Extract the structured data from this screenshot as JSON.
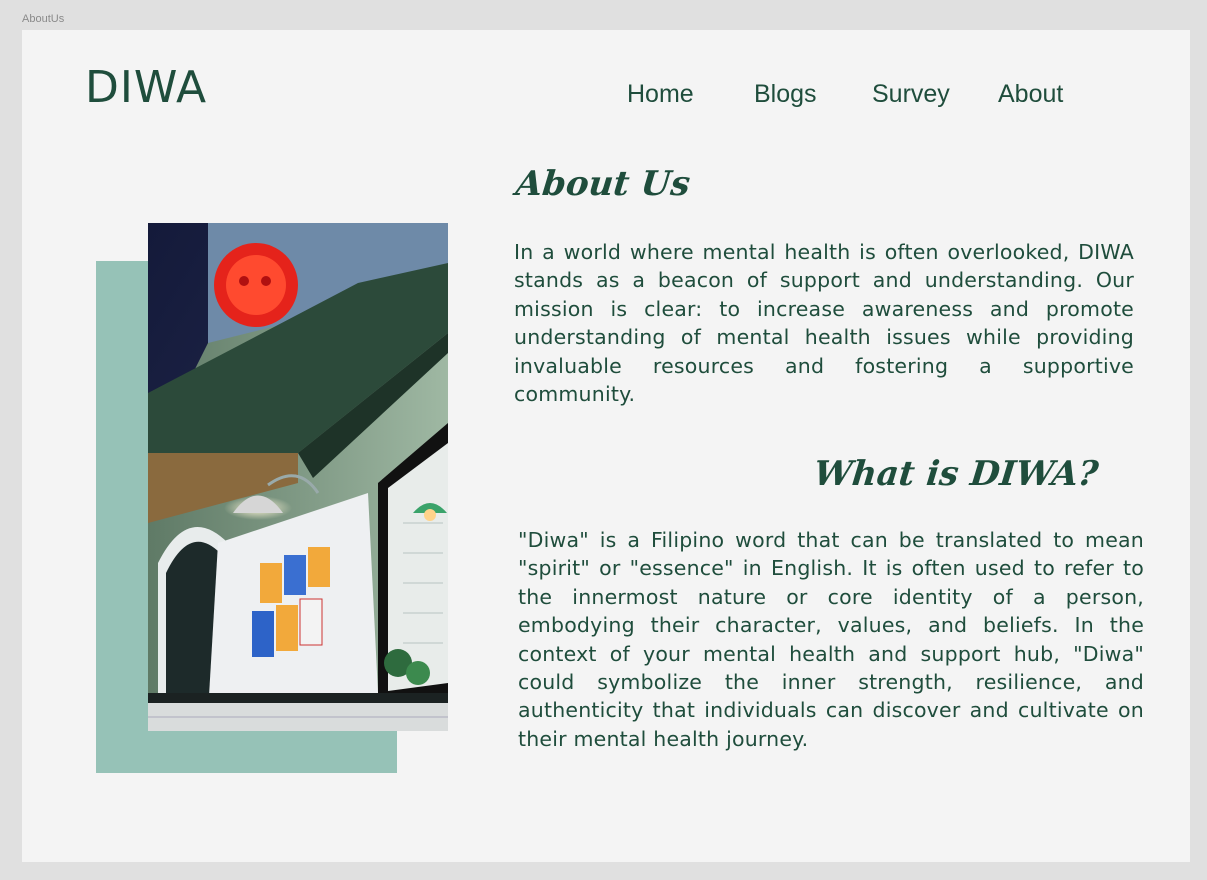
{
  "frame_label": "AboutUs",
  "brand": {
    "logo_text": "DIWA"
  },
  "nav": {
    "items": [
      {
        "label": "Home"
      },
      {
        "label": "Blogs"
      },
      {
        "label": "Survey"
      },
      {
        "label": "About"
      }
    ]
  },
  "about": {
    "heading": "About Us",
    "body": "In a world where mental health is often overlooked, DIWA stands as a beacon of support and understanding. Our mission is clear: to increase awareness and promote understanding of mental health issues while providing invaluable resources and fostering a supportive community."
  },
  "what": {
    "heading": "What is DIWA?",
    "body": "\"Diwa\" is a Filipino word that can be translated to mean \"spirit\" or \"essence\" in English. It is often used to refer to the innermost nature or core identity of a person, embodying their character, values, and beliefs. In the context of your mental health and support hub, \"Diwa\" could symbolize the inner strength, resilience, and authenticity that individuals can discover and cultivate on their mental health journey."
  },
  "colors": {
    "brand_green": "#1f4d3c",
    "accent_teal": "#96c2b7",
    "page_bg": "#f4f4f4"
  }
}
